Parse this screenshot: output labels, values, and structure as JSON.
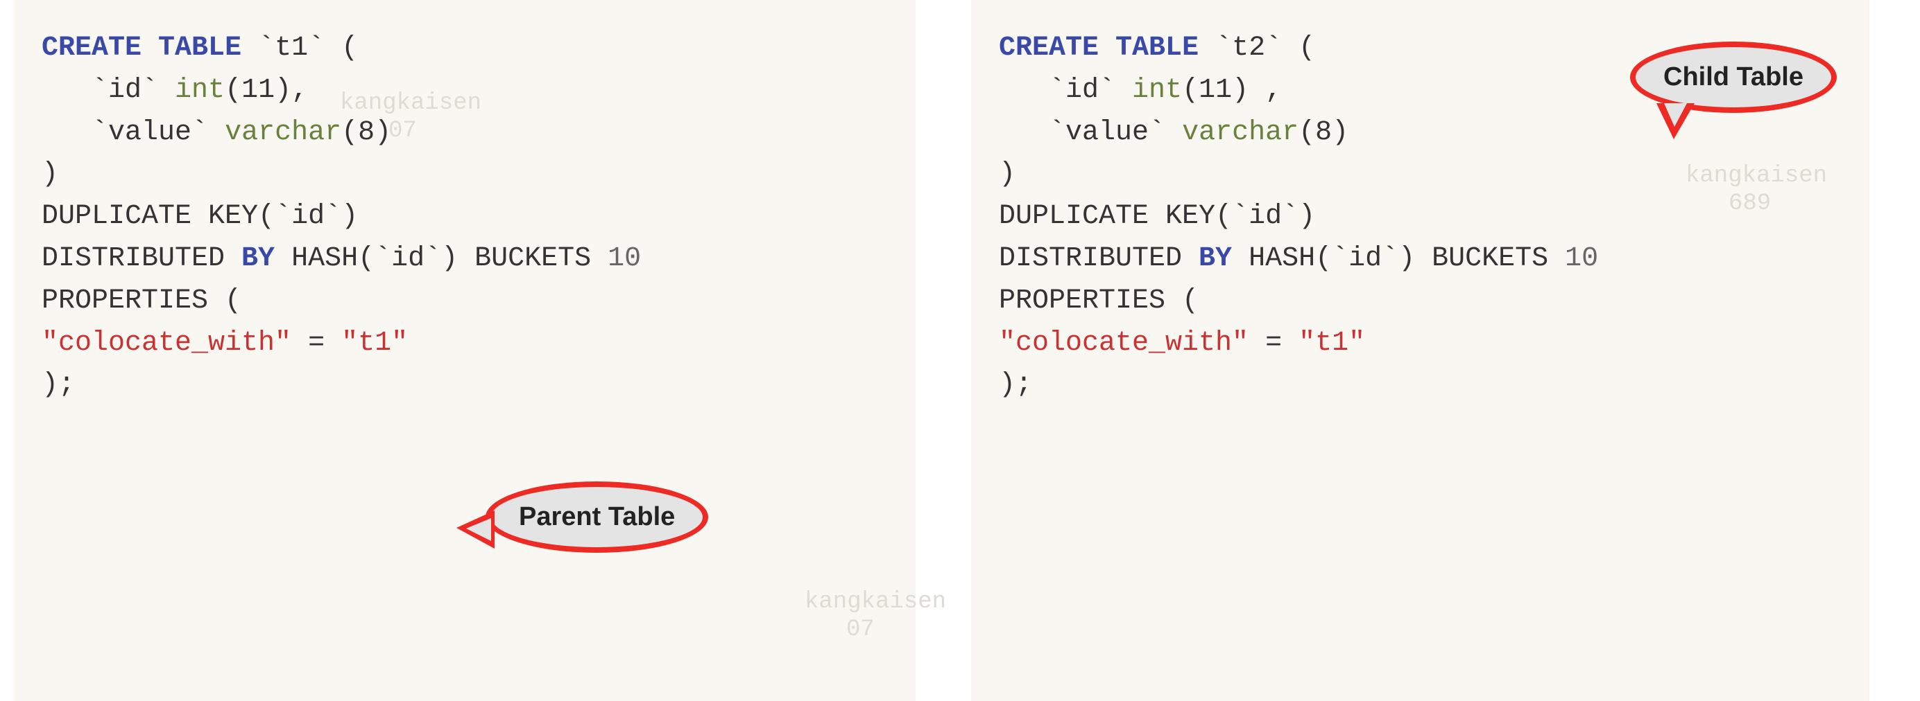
{
  "watermark": "kangkaisen",
  "watermark_num": "689",
  "watermark_num2": "07",
  "left": {
    "callout": "Parent Table",
    "code": {
      "l1": {
        "create": "CREATE",
        "table": "TABLE",
        "name": "`t1`",
        "open": " ("
      },
      "l2": {
        "indent": "   ",
        "col": "`id`",
        "sp": " ",
        "type": "int",
        "args": "(11),"
      },
      "l3": {
        "indent": "   ",
        "col": "`value`",
        "sp": " ",
        "type": "varchar",
        "args": "(8)"
      },
      "l4": ")",
      "l5": {
        "dup": "DUPLICATE KEY(",
        "id": "`id`",
        "close": ")"
      },
      "l6": {
        "dist": "DISTRIBUTED ",
        "by": "BY",
        "hash": " HASH(",
        "id": "`id`",
        "close": ") BUCKETS ",
        "buckets": "10"
      },
      "l7": "PROPERTIES (",
      "l8": {
        "k": "\"colocate_with\"",
        "eq": " = ",
        "v": "\"t1\""
      },
      "l9": ");"
    }
  },
  "right": {
    "callout": "Child Table",
    "code": {
      "l1": {
        "create": "CREATE",
        "table": "TABLE",
        "name": "`t2`",
        "open": " ("
      },
      "l2": {
        "indent": "   ",
        "col": "`id`",
        "sp": " ",
        "type": "int",
        "args": "(11) ,"
      },
      "l3": {
        "indent": "   ",
        "col": "`value`",
        "sp": " ",
        "type": "varchar",
        "args": "(8)"
      },
      "l4": ")",
      "l5": {
        "dup": "DUPLICATE KEY(",
        "id": "`id`",
        "close": ")"
      },
      "l6": {
        "dist": "DISTRIBUTED ",
        "by": "BY",
        "hash": " HASH(",
        "id": "`id`",
        "close": ") BUCKETS ",
        "buckets": "10"
      },
      "l7": "PROPERTIES (",
      "l8": {
        "k": "\"colocate_with\"",
        "eq": " = ",
        "v": "\"t1\""
      },
      "l9": ");"
    }
  }
}
